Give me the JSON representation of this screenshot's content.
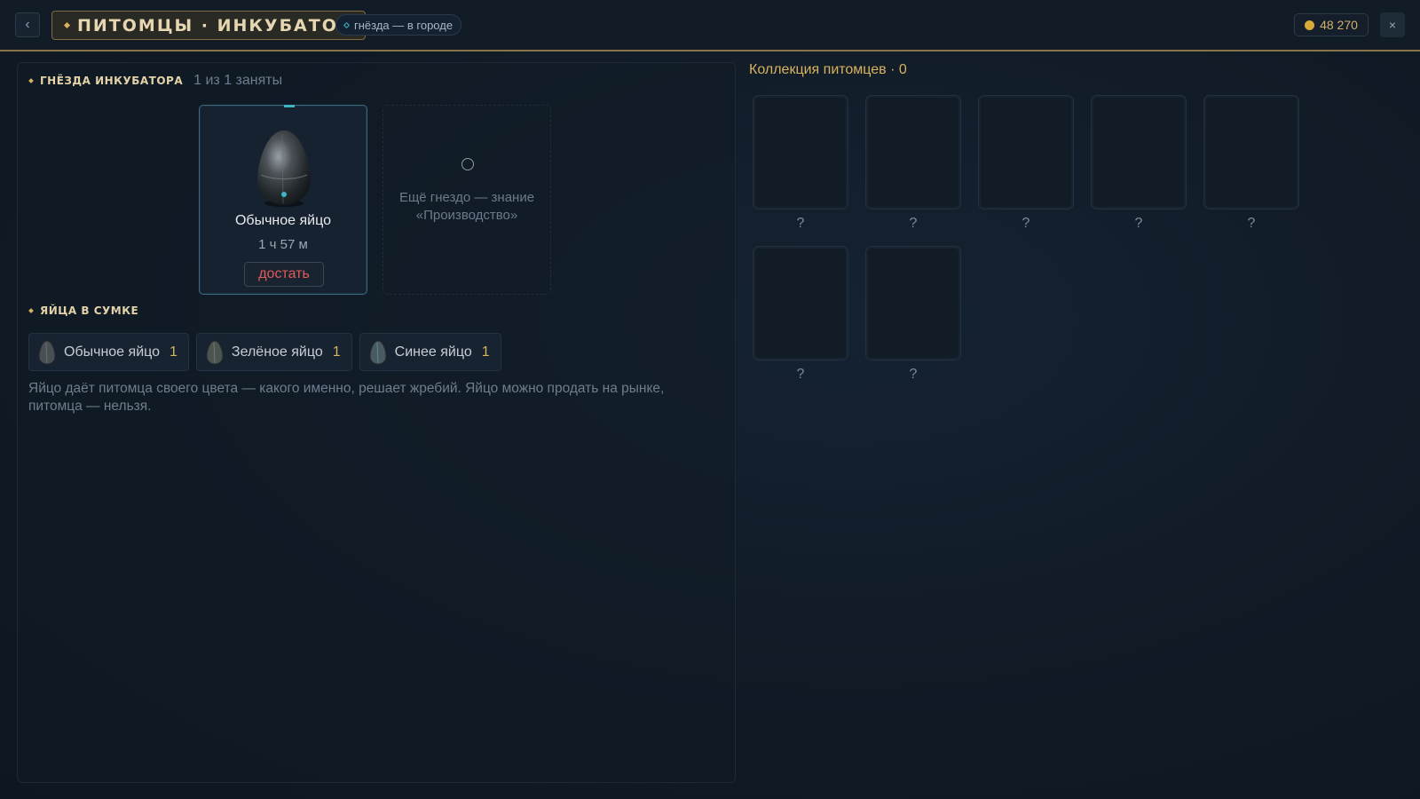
{
  "header": {
    "back_label": "‹",
    "title": "ПИТОМЦЫ · ИНКУБАТОР",
    "tag": "гнёзда — в городе",
    "coins": "48 270",
    "close_label": "×"
  },
  "incubator": {
    "heading": "ГНЁЗДА ИНКУБАТОРА",
    "occupancy": "1 из 1 заняты",
    "nest": {
      "egg_name": "Обычное яйцо",
      "timer": "1 ч 57 м",
      "take_label": "достать"
    },
    "locked_nest_text": "Ещё гнездо — знание «Производство»"
  },
  "bag": {
    "heading": "ЯЙЦА В СУМКЕ",
    "items": [
      {
        "name": "Обычное яйцо",
        "count": "1"
      },
      {
        "name": "Зелёное яйцо",
        "count": "1"
      },
      {
        "name": "Синее яйцо",
        "count": "1"
      }
    ],
    "description": "Яйцо даёт питомца своего цвета — какого именно, решает жребий. Яйцо можно продать на рынке, питомца — нельзя."
  },
  "collection": {
    "title": "Коллекция питомцев · 0",
    "slots": [
      "?",
      "?",
      "?",
      "?",
      "?",
      "?",
      "?"
    ]
  },
  "icons": {
    "back": "chevron-left-icon",
    "coin": "coin-icon",
    "close": "close-icon",
    "egg": "egg-icon",
    "empty_nest": "circle-icon"
  },
  "colors": {
    "accent_gold": "#d8b25e",
    "accent_teal": "#3fb5c2",
    "take_red": "#e05a58"
  }
}
